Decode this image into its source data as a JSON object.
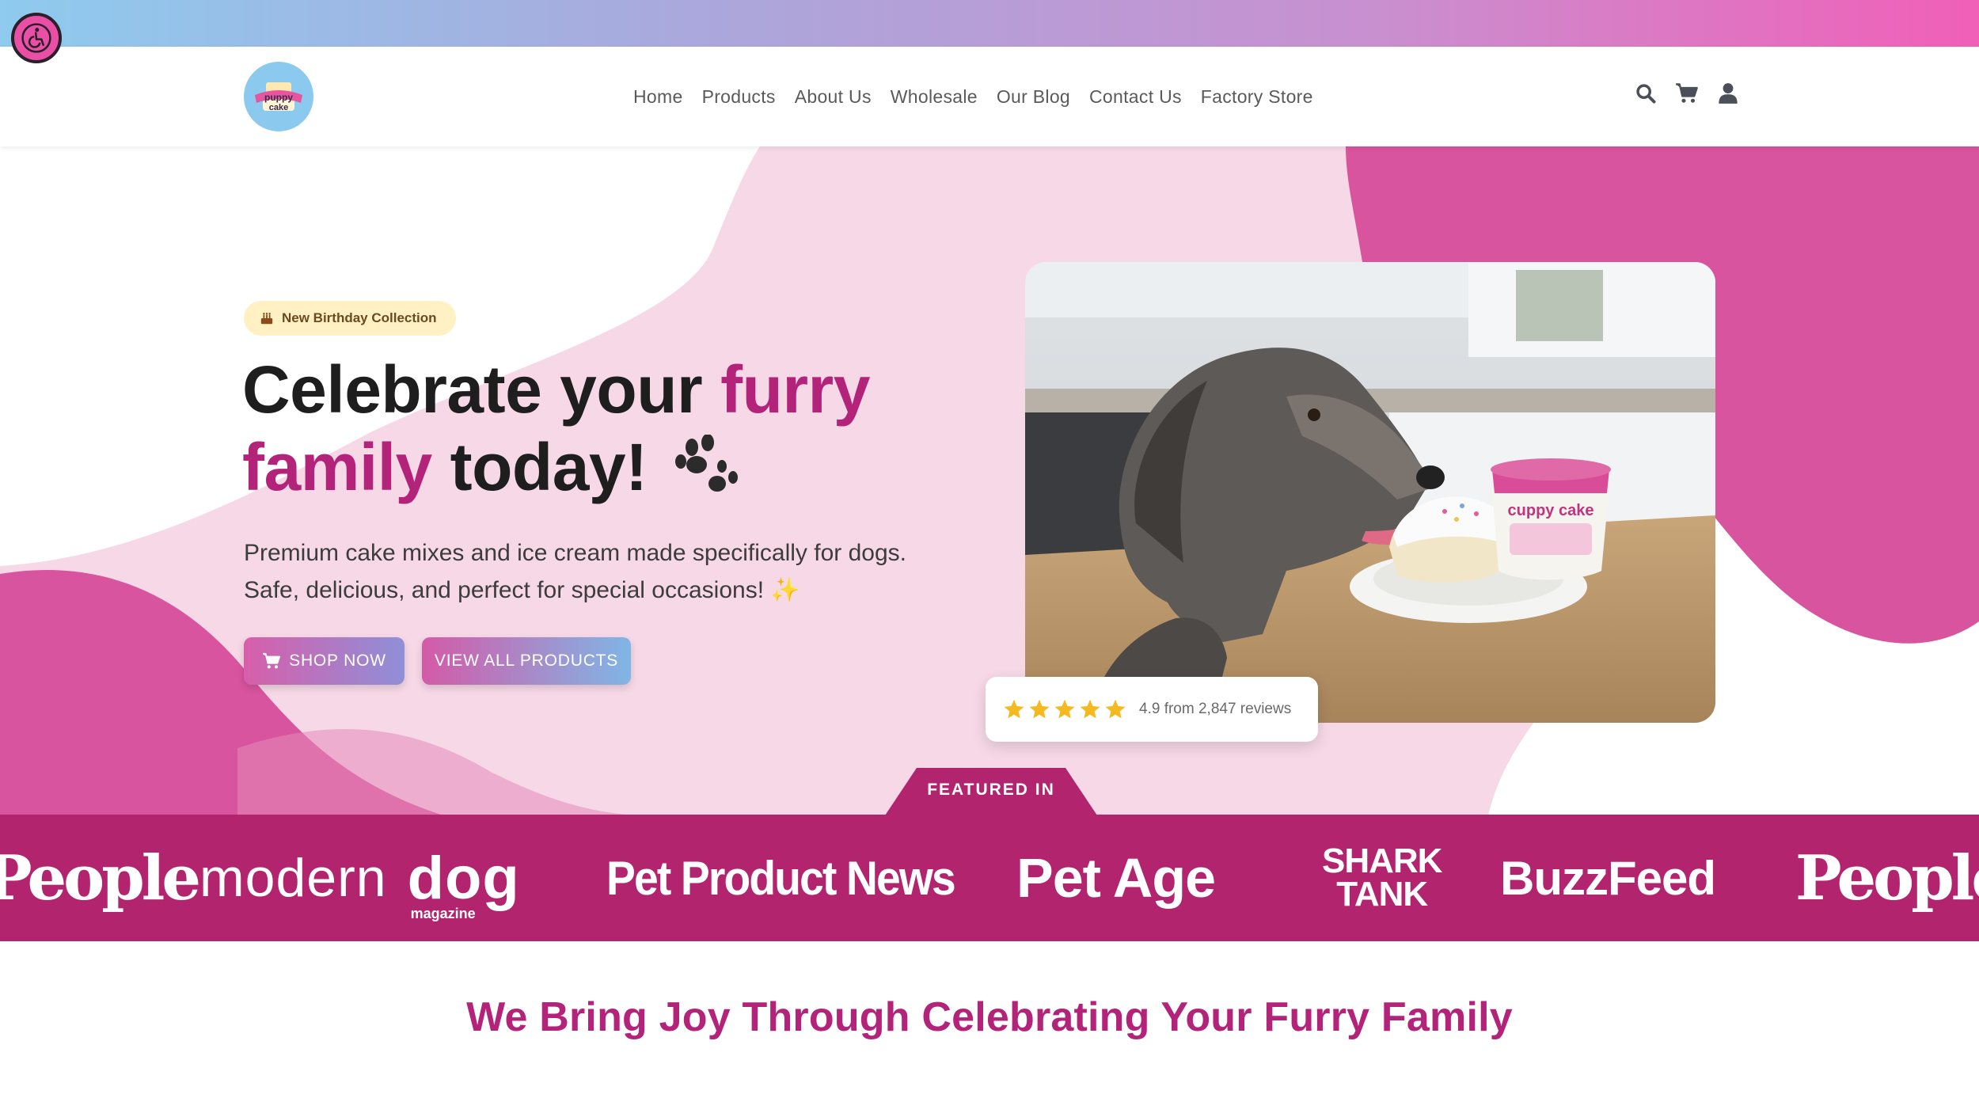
{
  "colors": {
    "accent": "#b3237a",
    "press_bar": "#b3246e",
    "hero_pink": "#f5d9e8",
    "blob_magenta": "#d9549e",
    "badge_bg": "#fff1c4",
    "star": "#f5b81f"
  },
  "accessibility": {
    "icon": "wheelchair-icon"
  },
  "logo": {
    "line1": "puppy",
    "line2": "cake"
  },
  "nav": {
    "links": [
      "Home",
      "Products",
      "About Us",
      "Wholesale",
      "Our Blog",
      "Contact Us",
      "Factory Store"
    ],
    "icons": [
      "search-icon",
      "cart-icon",
      "user-icon"
    ]
  },
  "hero": {
    "badge_icon": "cake-icon",
    "badge": "New Birthday Collection",
    "headline_part1": "Celebrate your",
    "headline_accent1": "furry",
    "headline_accent2": "family",
    "headline_part2": "today!",
    "headline_icon": "paw-icon",
    "subtext_line1": "Premium cake mixes and ice cream made specifically for dogs.",
    "subtext_line2": "Safe, delicious, and perfect for special occasions! ✨",
    "btn_shop": "SHOP NOW",
    "btn_view": "VIEW ALL PRODUCTS",
    "photo_label": "cuppy cake",
    "rating": {
      "stars": 5,
      "text": "4.9 from 2,847 reviews"
    }
  },
  "featured": {
    "label": "FEATURED IN",
    "logos": [
      "People",
      "modern",
      "dog",
      "magazine",
      "Pet Product News",
      "Pet Age",
      "SHARK",
      "TANK",
      "BuzzFeed",
      "People"
    ]
  },
  "tagline": "We Bring Joy Through Celebrating Your Furry Family"
}
